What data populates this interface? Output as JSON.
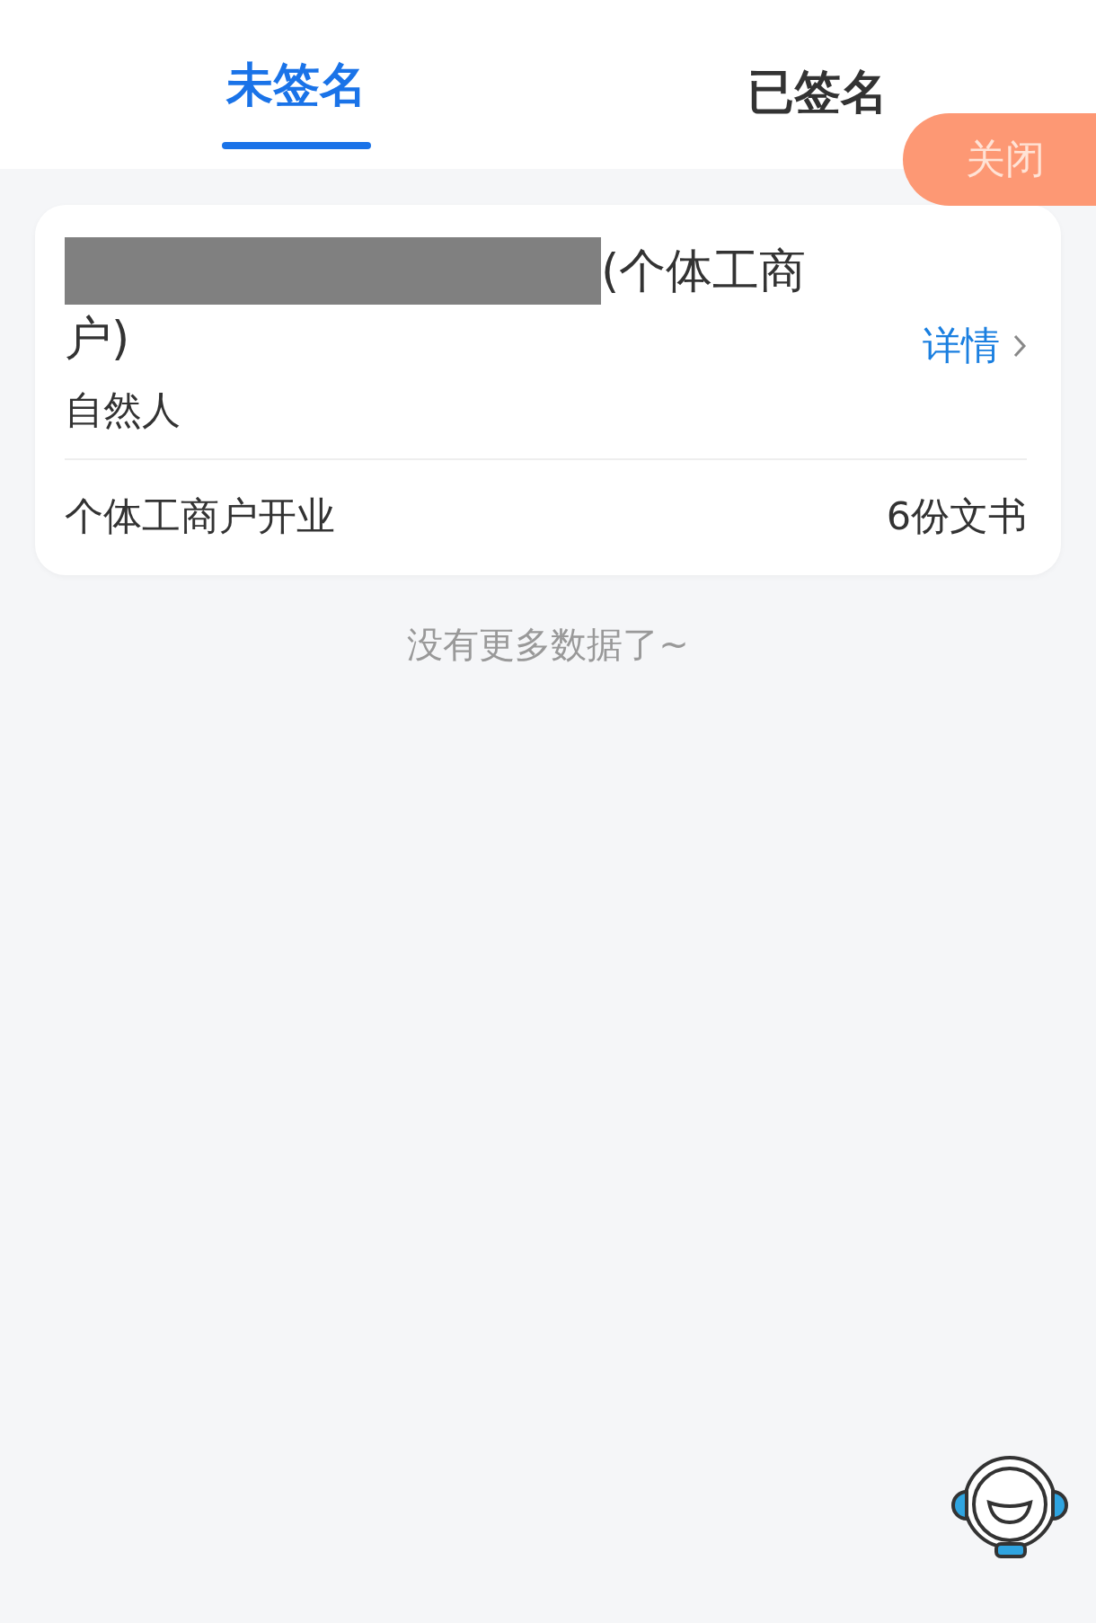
{
  "tabs": [
    {
      "label": "未签名",
      "selected": true
    },
    {
      "label": "已签名",
      "selected": false
    }
  ],
  "close_button": {
    "label": "关闭"
  },
  "records": [
    {
      "name": "(个体工商户)",
      "name_redacted": true,
      "subject_type": "自然人",
      "detail_link": "详情",
      "business": "个体工商户开业",
      "documents": "6份文书"
    }
  ],
  "list_end": "没有更多数据了~"
}
